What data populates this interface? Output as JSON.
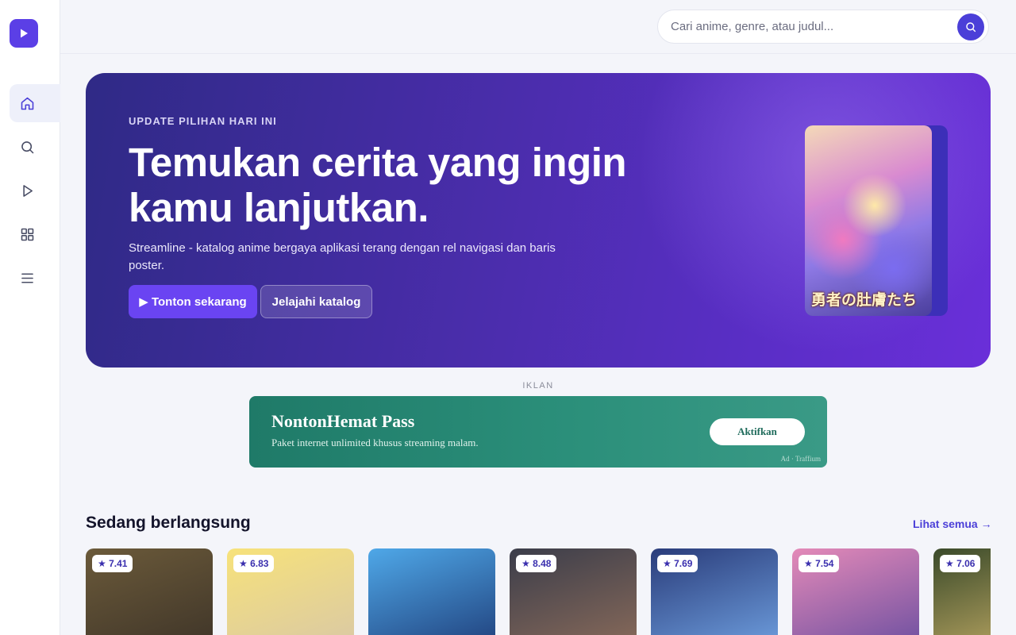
{
  "sidebar": {
    "logo_icon": "play-icon",
    "items": [
      {
        "icon": "home-icon",
        "active": true
      },
      {
        "icon": "search-icon",
        "active": false
      },
      {
        "icon": "play-icon",
        "active": false
      },
      {
        "icon": "grid-icon",
        "active": false
      },
      {
        "icon": "menu-icon",
        "active": false
      }
    ]
  },
  "header": {
    "search": {
      "placeholder": "Cari anime, genre, atau judul...",
      "value": "",
      "button_icon": "search-icon"
    }
  },
  "hero": {
    "eyebrow": "UPDATE PILIHAN HARI INI",
    "title_line1": "Temukan cerita yang ingin",
    "title_line2": "kamu lanjutkan.",
    "description": "Streamline - katalog anime bergaya aplikasi terang dengan rel navigasi dan baris poster.",
    "primary_button": "▶ Tonton sekarang",
    "secondary_button": "Jelajahi katalog",
    "poster_title": "勇者の肚膚たち"
  },
  "ad": {
    "label": "IKLAN",
    "title": "NontonHemat Pass",
    "subtitle": "Paket internet unlimited khusus streaming malam.",
    "button": "Aktifkan",
    "tag": "Ad · Traffium"
  },
  "section": {
    "title": "Sedang berlangsung",
    "see_all": "Lihat semua →",
    "cards": [
      {
        "rating": "★ 7.41",
        "colors": [
          "#6b5a3a",
          "#3e3428"
        ]
      },
      {
        "rating": "★ 6.83",
        "colors": [
          "#f7e27a",
          "#d9c8a6"
        ]
      },
      {
        "rating": "",
        "colors": [
          "#4fa8e8",
          "#1f3e7a"
        ]
      },
      {
        "rating": "★ 8.48",
        "colors": [
          "#3b3d4a",
          "#8a6b5a"
        ]
      },
      {
        "rating": "★ 7.69",
        "colors": [
          "#2a3c7a",
          "#6fa0e0"
        ]
      },
      {
        "rating": "★ 7.54",
        "colors": [
          "#e48ab8",
          "#6a4ea0"
        ]
      },
      {
        "rating": "★ 7.06",
        "colors": [
          "#3a4a2a",
          "#c8b068"
        ]
      }
    ]
  },
  "colors": {
    "accent": "#4b3fd8",
    "hero_start": "#2f2a86",
    "hero_end": "#6a2fd9",
    "ad_bg": "#1f7a68"
  }
}
